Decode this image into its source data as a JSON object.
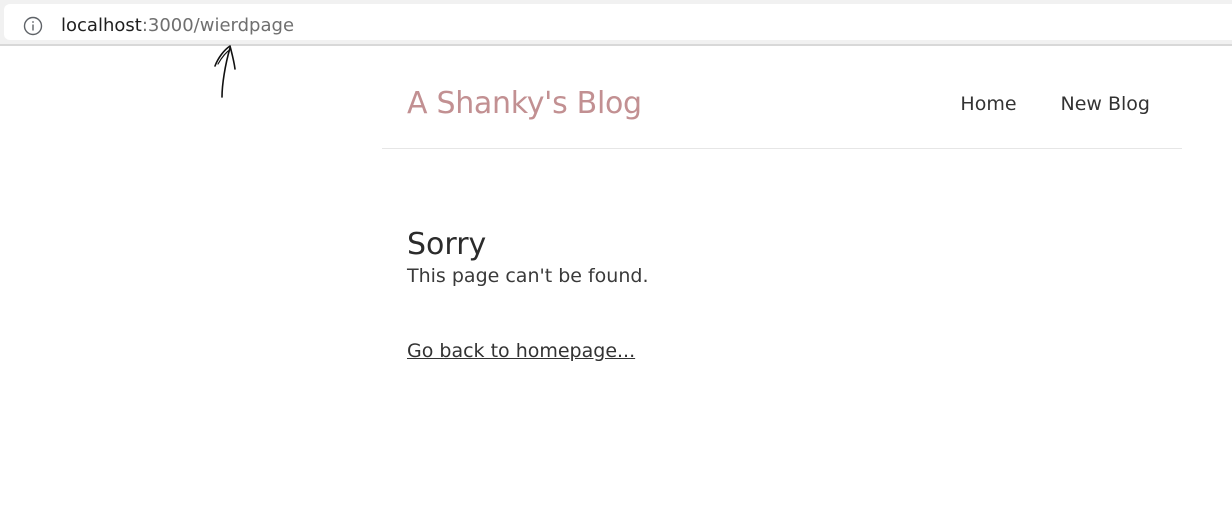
{
  "browser": {
    "url_host": "localhost",
    "url_path": ":3000/wierdpage",
    "info_icon": "info-circle-icon"
  },
  "navbar": {
    "brand": "A Shanky's Blog",
    "links": [
      {
        "label": "Home"
      },
      {
        "label": "New Blog"
      }
    ]
  },
  "not_found": {
    "title": "Sorry",
    "message": "This page can't be found.",
    "back_link": "Go back to homepage..."
  },
  "colors": {
    "brand": "#c29092",
    "text": "#333333",
    "divider": "#e6e6e6"
  }
}
